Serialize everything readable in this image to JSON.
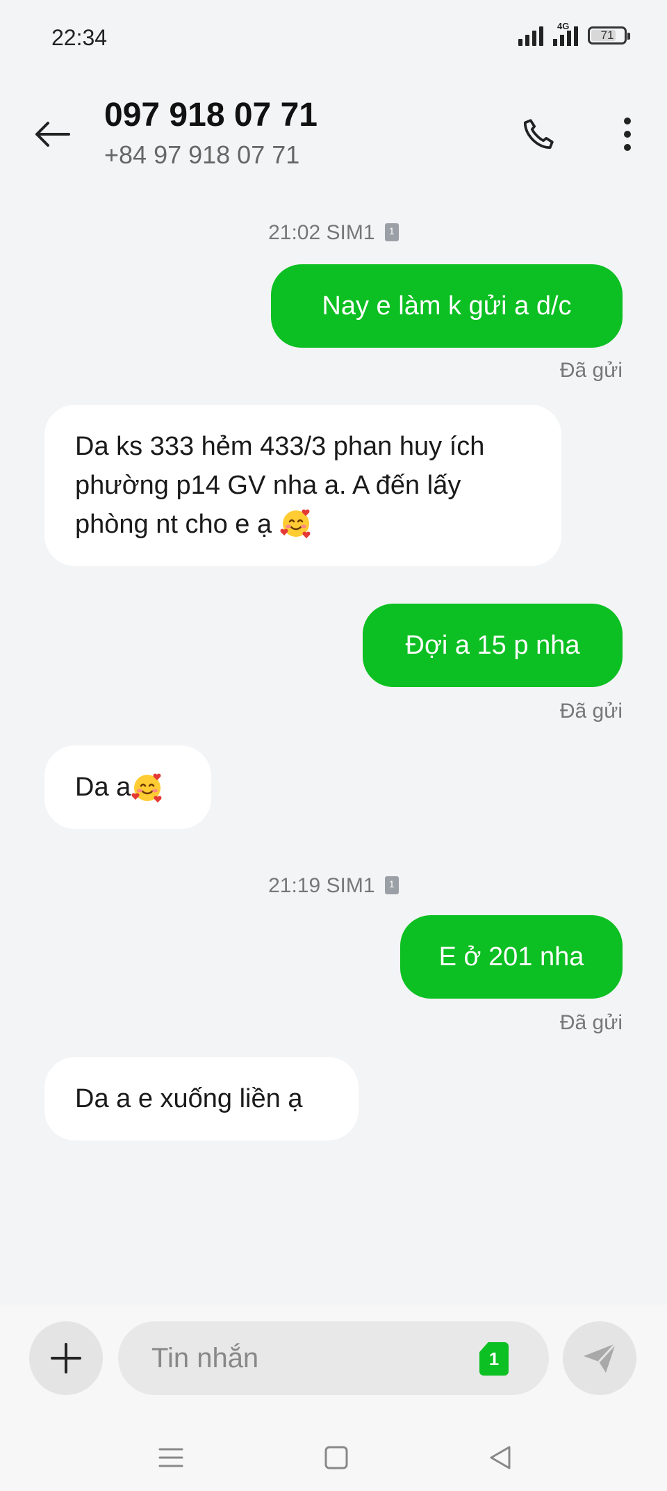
{
  "status_bar": {
    "time": "22:34",
    "network_label": "4G",
    "battery_level": "71"
  },
  "header": {
    "title": "097 918 07 71",
    "subtitle": "+84 97 918 07 71"
  },
  "conversation": {
    "timestamps": [
      {
        "time": "21:02",
        "sim": "SIM1"
      },
      {
        "time": "21:19",
        "sim": "SIM1"
      }
    ],
    "messages": [
      {
        "direction": "out",
        "text": "Nay e làm k gửi a d/c",
        "status": "Đã gửi"
      },
      {
        "direction": "in",
        "lines": [
          "Da ks 333 hẻm 433/3 phan huy ích",
          "phường p14 GV nha a. A đến lấy",
          "phòng nt cho e ạ"
        ],
        "emoji": "smiling-face-with-hearts"
      },
      {
        "direction": "out",
        "text": "Đợi a 15 p nha",
        "status": "Đã gửi"
      },
      {
        "direction": "in",
        "text": "Da a",
        "emoji": "smiling-face-with-hearts"
      },
      {
        "direction": "out",
        "text": "E ở 201 nha",
        "status": "Đã gửi"
      },
      {
        "direction": "in",
        "text": "Da a e xuống liền ạ"
      }
    ]
  },
  "composer": {
    "placeholder": "Tin nhắn",
    "sim_badge": "1"
  },
  "colors": {
    "outgoing_bubble": "#0cbf22",
    "incoming_bubble": "#ffffff",
    "background": "#f3f4f6"
  },
  "icons": {
    "back": "arrow-left-icon",
    "call": "phone-icon",
    "more": "more-vertical-icon",
    "add": "plus-icon",
    "send": "send-icon",
    "nav_menu": "menu-icon",
    "nav_home": "square-icon",
    "nav_back": "triangle-back-icon"
  }
}
